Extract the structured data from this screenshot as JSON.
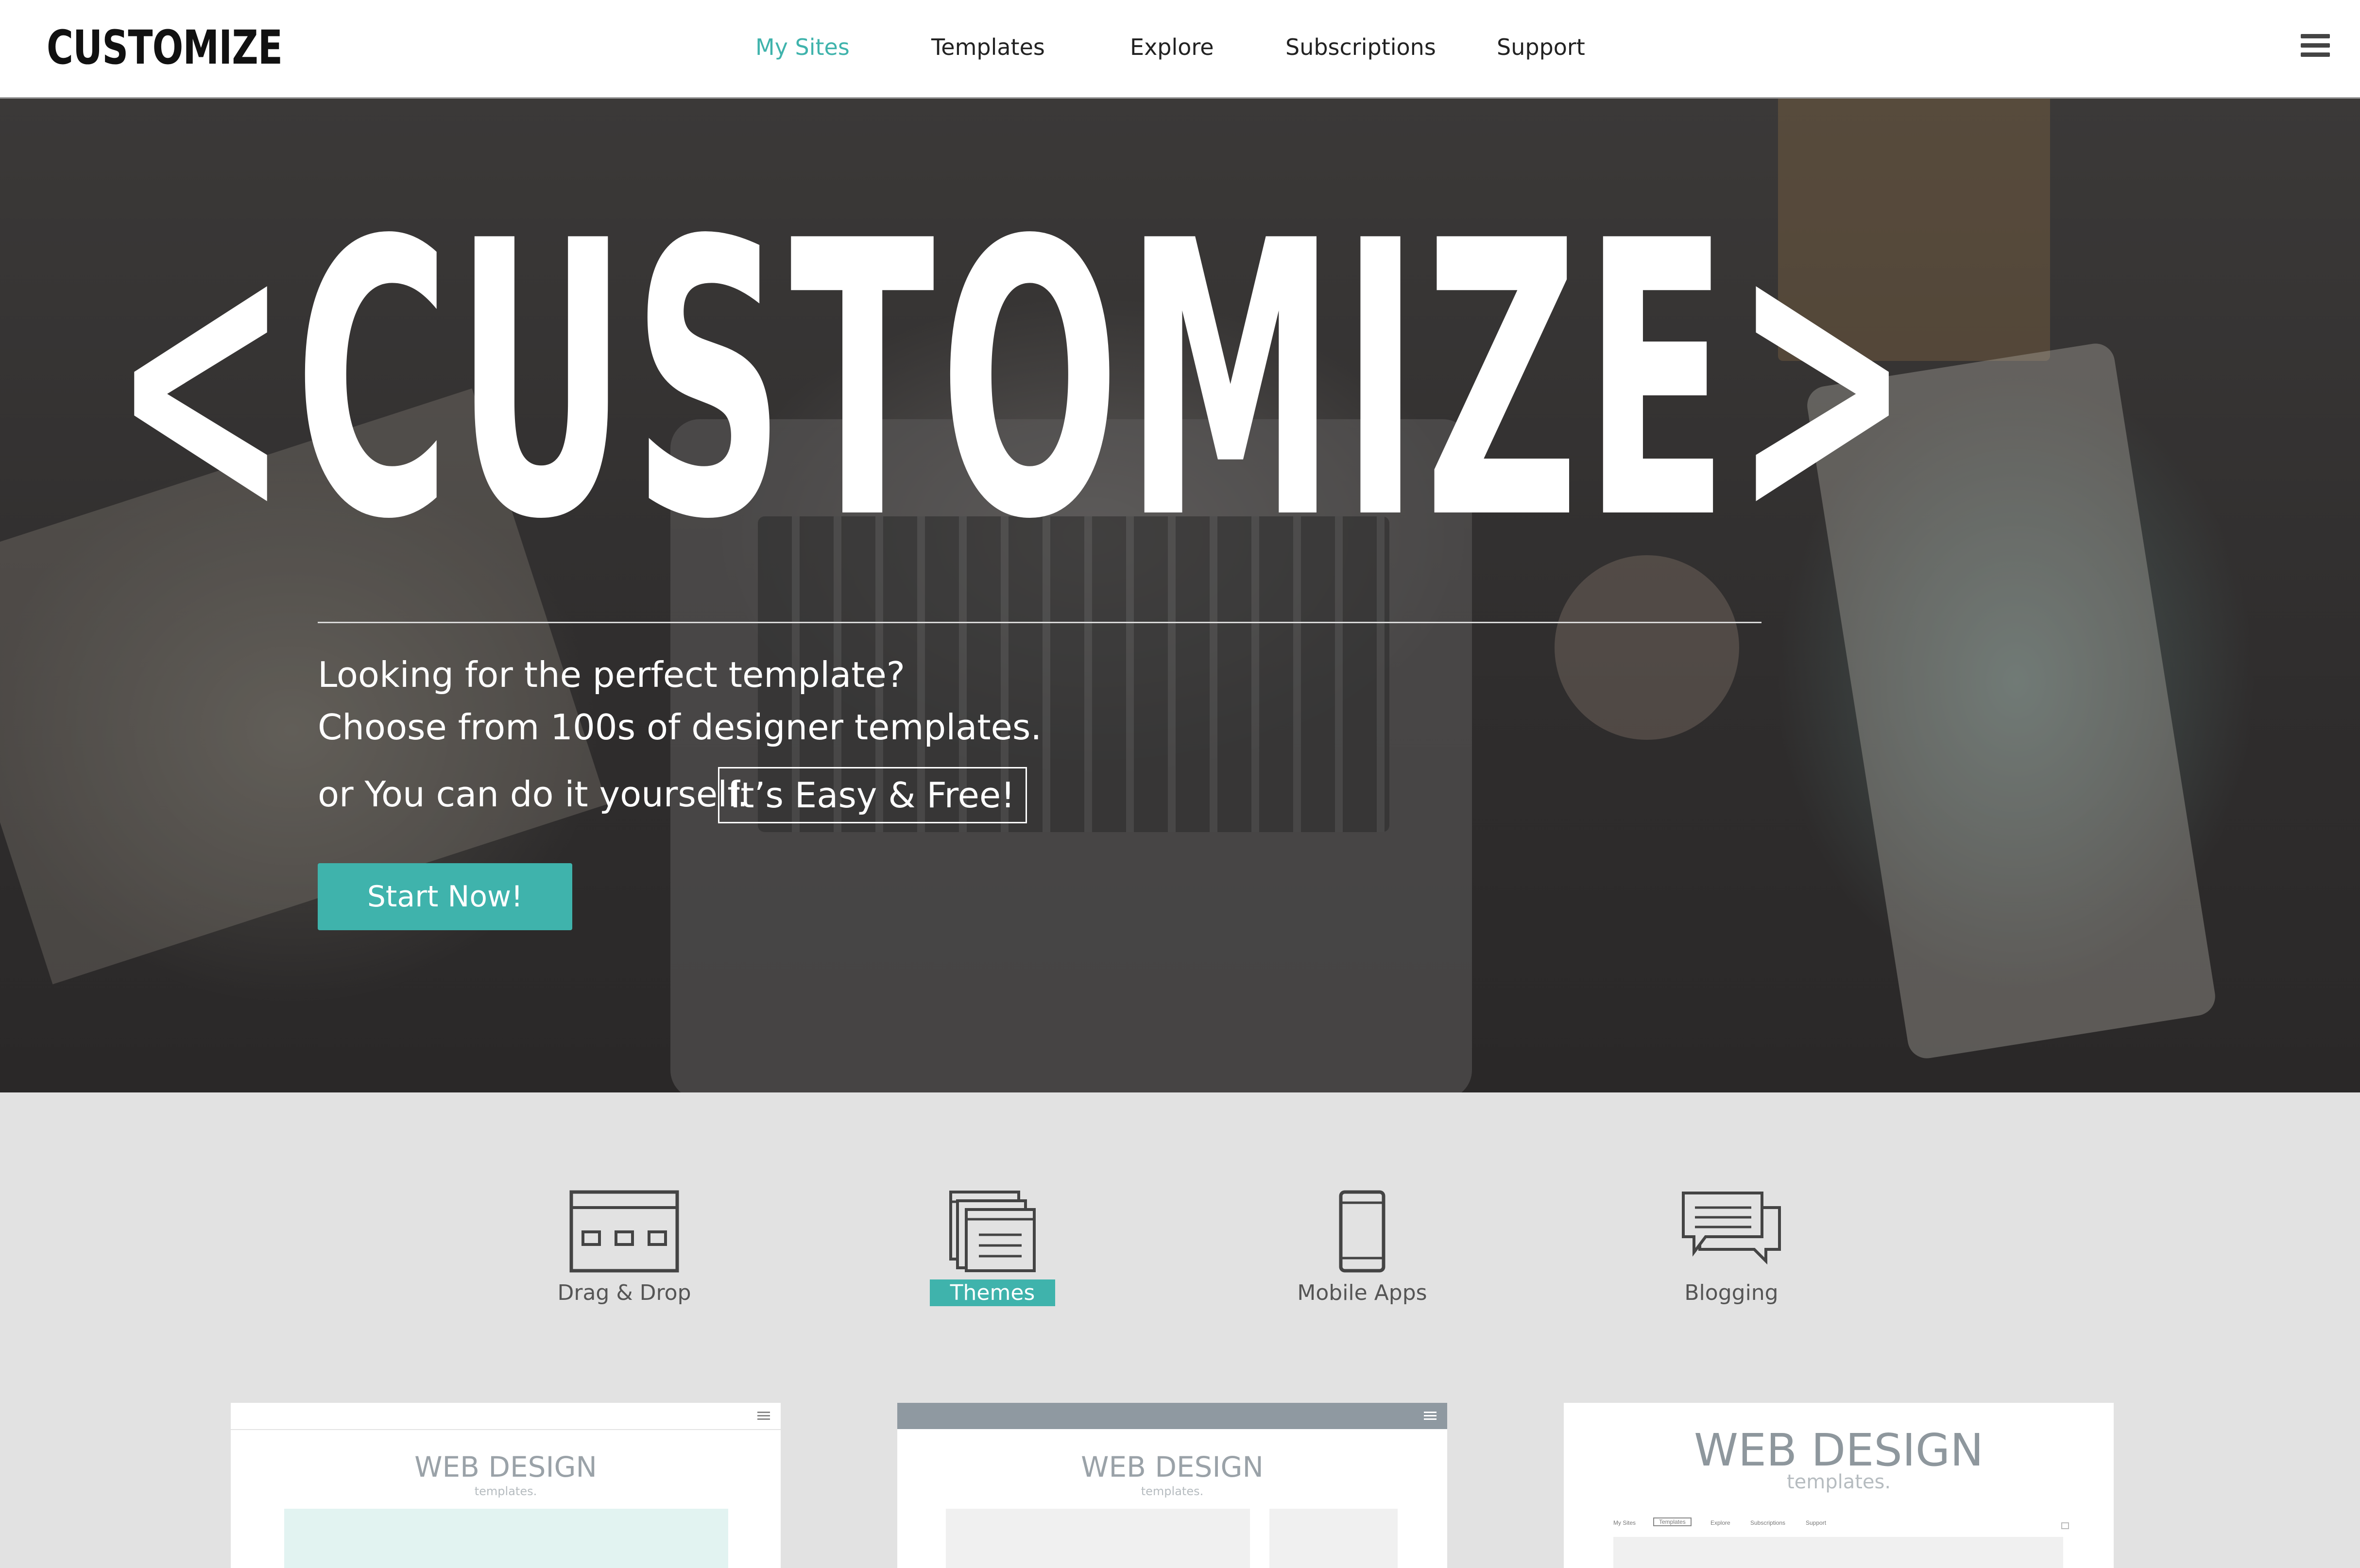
{
  "app": {
    "logo": "CUSTOMIZE"
  },
  "nav": {
    "items": [
      {
        "label": "My Sites",
        "active": true
      },
      {
        "label": "Templates",
        "active": false
      },
      {
        "label": "Explore",
        "active": false
      },
      {
        "label": "Subscriptions",
        "active": false
      },
      {
        "label": "Support",
        "active": false
      }
    ],
    "menu_icon": "hamburger-icon"
  },
  "hero": {
    "headline": "<CUSTOMIZE>",
    "line1": "Looking for the perfect template?",
    "line2": "Choose from 100s of designer templates.",
    "line3": "or You can do it yourself.",
    "highlight": "It’s Easy & Free!",
    "cta_label": "Start Now!"
  },
  "features": [
    {
      "label": "Drag & Drop",
      "icon": "drag-drop-icon",
      "active": false
    },
    {
      "label": "Themes",
      "icon": "themes-icon",
      "active": true
    },
    {
      "label": "Mobile Apps",
      "icon": "mobile-icon",
      "active": false
    },
    {
      "label": "Blogging",
      "icon": "chat-icon",
      "active": false
    }
  ],
  "templates": [
    {
      "title": "WEB DESIGN",
      "subtitle": "templates."
    },
    {
      "title": "WEB DESIGN",
      "subtitle": "templates."
    },
    {
      "title": "WEB DESIGN",
      "subtitle": "templates.",
      "mini_nav": [
        "My Sites",
        "Templates",
        "Explore",
        "Subscriptions",
        "Support"
      ]
    }
  ],
  "colors": {
    "accent": "#3fb3ac",
    "background": "#e2e2e2",
    "hero_overlay": "#2f2d2d"
  }
}
